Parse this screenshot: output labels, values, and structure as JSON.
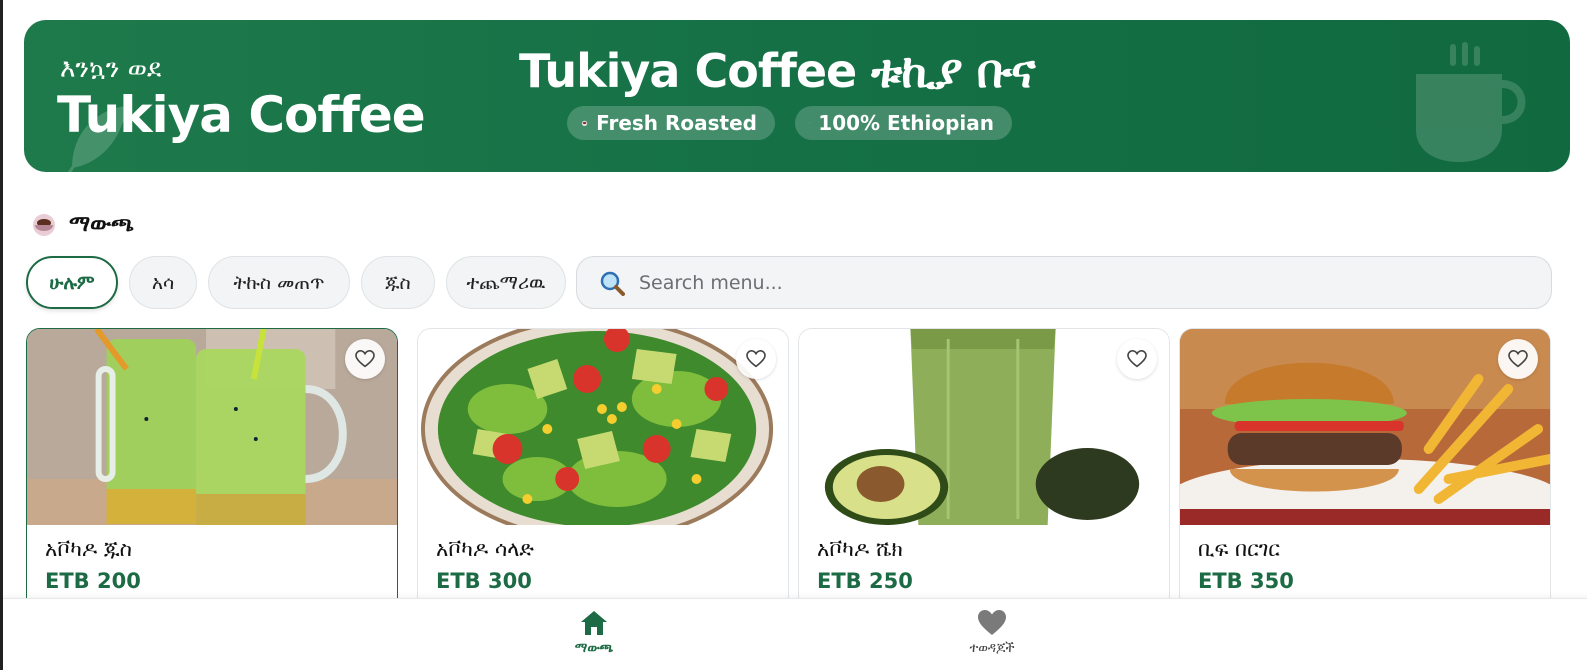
{
  "header": {
    "welcome": "እንኳን ወደ",
    "brand": "Tukiya Coffee",
    "center_title": "Tukiya Coffee ቱኪያ ቡና",
    "badges": [
      {
        "label": "Fresh Roasted",
        "icon": "coffee-cup-icon"
      },
      {
        "label": "100% Ethiopian",
        "icon": "leaf-icon"
      }
    ]
  },
  "section": {
    "title": "ማውጫ",
    "icon": "coffee-cup-icon"
  },
  "filters": [
    {
      "label": "ሁሉም",
      "active": true
    },
    {
      "label": "አሳ",
      "active": false
    },
    {
      "label": "ትኩስ መጠጥ",
      "active": false
    },
    {
      "label": "ጁስ",
      "active": false
    },
    {
      "label": "ተጨማሪዉ",
      "active": false
    }
  ],
  "search": {
    "placeholder": "Search menu...",
    "value": ""
  },
  "menu_items": [
    {
      "name": "አቮካዶ ጁስ",
      "price": "ETB 200",
      "image": "avocado-juice-photo"
    },
    {
      "name": "አቮካዶ ሳላድ",
      "price": "ETB 300",
      "image": "avocado-salad-photo"
    },
    {
      "name": "አቮካዶ ሼክ",
      "price": "ETB 250",
      "image": "avocado-shake-photo"
    },
    {
      "name": "ቢፍ በርገር",
      "price": "ETB 350",
      "image": "beef-burger-photo"
    }
  ],
  "bottom_nav": [
    {
      "label": "ማውጫ",
      "icon": "home-icon",
      "active": true
    },
    {
      "label": "ተወዳጆች",
      "icon": "heart-icon",
      "active": false
    }
  ],
  "colors": {
    "primary": "#1d6b45",
    "header_bg": "#157046",
    "chip_bg": "#f2f4f5"
  }
}
